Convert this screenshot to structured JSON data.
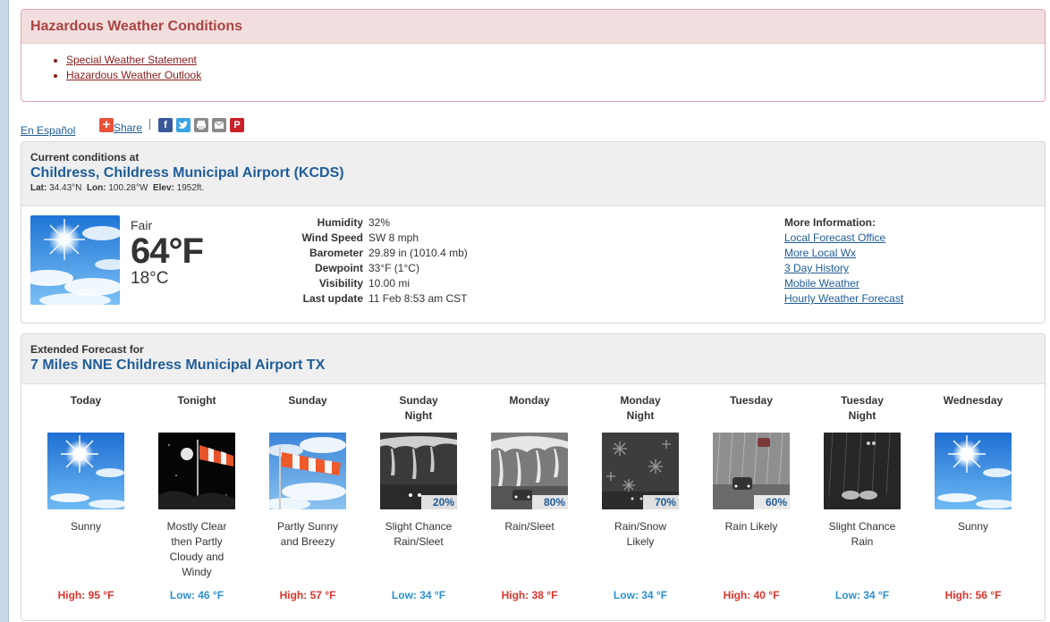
{
  "hazard": {
    "title": "Hazardous Weather Conditions",
    "links": [
      "Special Weather Statement",
      "Hazardous Weather Outlook"
    ]
  },
  "share": {
    "espanol": "En Español",
    "share_label": "Share",
    "icons": [
      "facebook-icon",
      "twitter-icon",
      "print-icon",
      "email-icon",
      "pinterest-icon"
    ]
  },
  "current": {
    "label": "Current conditions at",
    "station": "Childress, Childress Municipal Airport (KCDS)",
    "lat_label": "Lat:",
    "lat": "34.43°N",
    "lon_label": "Lon:",
    "lon": "100.28°W",
    "elev_label": "Elev:",
    "elev": "1952ft.",
    "condition": "Fair",
    "temp_f": "64°F",
    "temp_c": "18°C",
    "details": [
      {
        "label": "Humidity",
        "value": "32%"
      },
      {
        "label": "Wind Speed",
        "value": "SW 8 mph"
      },
      {
        "label": "Barometer",
        "value": "29.89 in (1010.4 mb)"
      },
      {
        "label": "Dewpoint",
        "value": "33°F (1°C)"
      },
      {
        "label": "Visibility",
        "value": "10.00 mi"
      },
      {
        "label": "Last update",
        "value": "11 Feb 8:53 am CST"
      }
    ],
    "more_info_title": "More Information:",
    "more_links": [
      "Local Forecast Office",
      "More Local Wx",
      "3 Day History",
      "Mobile Weather",
      "Hourly Weather Forecast"
    ]
  },
  "extended": {
    "label": "Extended Forecast for",
    "location": "7 Miles NNE Childress Municipal Airport TX",
    "periods": [
      {
        "name": [
          "Today",
          ""
        ],
        "icon": "sunny",
        "pop": "",
        "desc": [
          "Sunny"
        ],
        "temp": "High: 95 °F",
        "kind": "high"
      },
      {
        "name": [
          "Tonight",
          ""
        ],
        "icon": "night-wind",
        "pop": "",
        "desc": [
          "Mostly Clear",
          "then Partly",
          "Cloudy and",
          "Windy"
        ],
        "temp": "Low: 46 °F",
        "kind": "low"
      },
      {
        "name": [
          "Sunday",
          ""
        ],
        "icon": "windsock",
        "pop": "",
        "desc": [
          "Partly Sunny",
          "and Breezy"
        ],
        "temp": "High: 57 °F",
        "kind": "high"
      },
      {
        "name": [
          "Sunday",
          "Night"
        ],
        "icon": "sleet-night",
        "pop": "20%",
        "desc": [
          "Slight Chance",
          "Rain/Sleet"
        ],
        "temp": "Low: 34 °F",
        "kind": "low"
      },
      {
        "name": [
          "Monday",
          ""
        ],
        "icon": "sleet-day",
        "pop": "80%",
        "desc": [
          "Rain/Sleet"
        ],
        "temp": "High: 38 °F",
        "kind": "high"
      },
      {
        "name": [
          "Monday",
          "Night"
        ],
        "icon": "snow-night",
        "pop": "70%",
        "desc": [
          "Rain/Snow",
          "Likely"
        ],
        "temp": "Low: 34 °F",
        "kind": "low"
      },
      {
        "name": [
          "Tuesday",
          ""
        ],
        "icon": "rain-day",
        "pop": "60%",
        "desc": [
          "Rain Likely"
        ],
        "temp": "High: 40 °F",
        "kind": "high"
      },
      {
        "name": [
          "Tuesday",
          "Night"
        ],
        "icon": "rain-night",
        "pop": "",
        "desc": [
          "Slight Chance",
          "Rain"
        ],
        "temp": "Low: 34 °F",
        "kind": "low"
      },
      {
        "name": [
          "Wednesday",
          ""
        ],
        "icon": "sunny",
        "pop": "",
        "desc": [
          "Sunny"
        ],
        "temp": "High: 56 °F",
        "kind": "high"
      }
    ]
  },
  "colors": {
    "link": "#1f5c99",
    "hazard": "#a94442",
    "high": "#d9342b",
    "low": "#2d8fd0"
  }
}
